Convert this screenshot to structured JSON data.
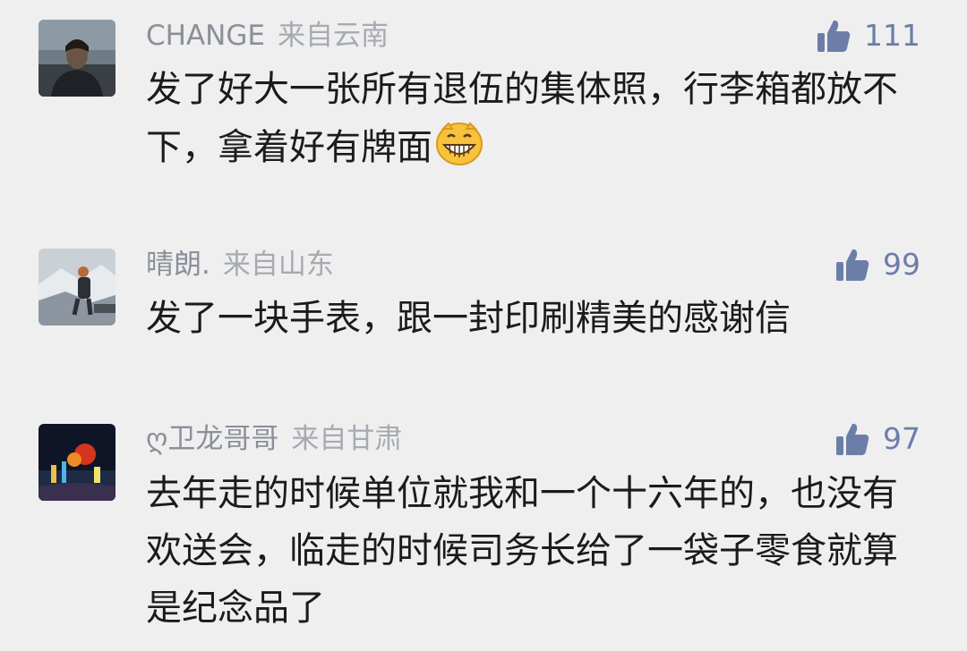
{
  "comments": [
    {
      "username": "CHANGE",
      "location": "来自云南",
      "likes": "111",
      "text": "发了好大一张所有退伍的集体照，行李箱都放不下，拿着好有牌面",
      "emoji": "grinning-face-emoji"
    },
    {
      "username": "晴朗.",
      "location": "来自山东",
      "likes": "99",
      "text": "发了一块手表，跟一封印刷精美的感谢信"
    },
    {
      "username": "ღ卫龙哥哥",
      "location": "来自甘肃",
      "likes": "97",
      "text": "去年走的时候单位就我和一个十六年的，也没有欢送会，临走的时候司务长给了一袋子零食就算是纪念品了"
    }
  ],
  "icons": {
    "like": "thumbs-up-icon"
  },
  "colors": {
    "background": "#efeff0",
    "username": "#8a8f98",
    "like": "#6c7ea8",
    "text": "#1b1b1b"
  }
}
